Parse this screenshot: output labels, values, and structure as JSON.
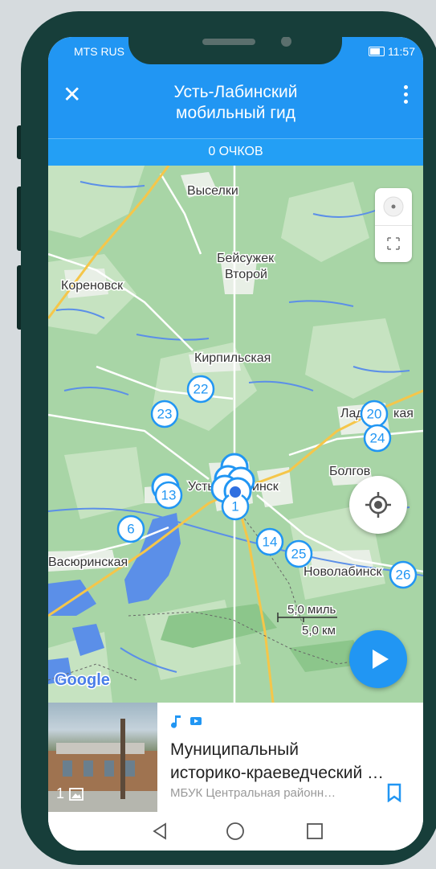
{
  "status": {
    "carrier": "MTS RUS",
    "time": "11:57"
  },
  "appbar": {
    "title_line1": "Усть-Лабинский",
    "title_line2": "мобильный гид",
    "close_icon": "close-icon",
    "menu_icon": "more-vert-icon"
  },
  "points_label": "0 ОЧКОВ",
  "map": {
    "places": [
      {
        "name": "Выселки"
      },
      {
        "name": "Бейсужек"
      },
      {
        "name": "Второй"
      },
      {
        "name": "Кореновск"
      },
      {
        "name": "Кирпильская"
      },
      {
        "name": "Лад"
      },
      {
        "name": "кая"
      },
      {
        "name": "Болгов"
      },
      {
        "name": "Усть"
      },
      {
        "name": "инск"
      },
      {
        "name": "Васюринская"
      },
      {
        "name": "Новолабинск"
      }
    ],
    "markers": [
      "22",
      "23",
      "20",
      "24",
      "13",
      "1",
      "6",
      "14",
      "25",
      "26"
    ],
    "scale": {
      "miles": "5,0 миль",
      "km": "5,0 км"
    },
    "logo": "Google"
  },
  "card": {
    "photo_count": "1",
    "title_line1": "Муниципальный",
    "title_line2": "историко-краеведческий …",
    "subtitle": "МБУК Центральная районн…",
    "icons": [
      "music-note-icon",
      "video-icon",
      "bookmark-icon"
    ]
  },
  "colors": {
    "accent": "#2196f3",
    "frame": "#173e3a",
    "map_green": "#a8d5a6",
    "water": "#5b8fe8"
  }
}
